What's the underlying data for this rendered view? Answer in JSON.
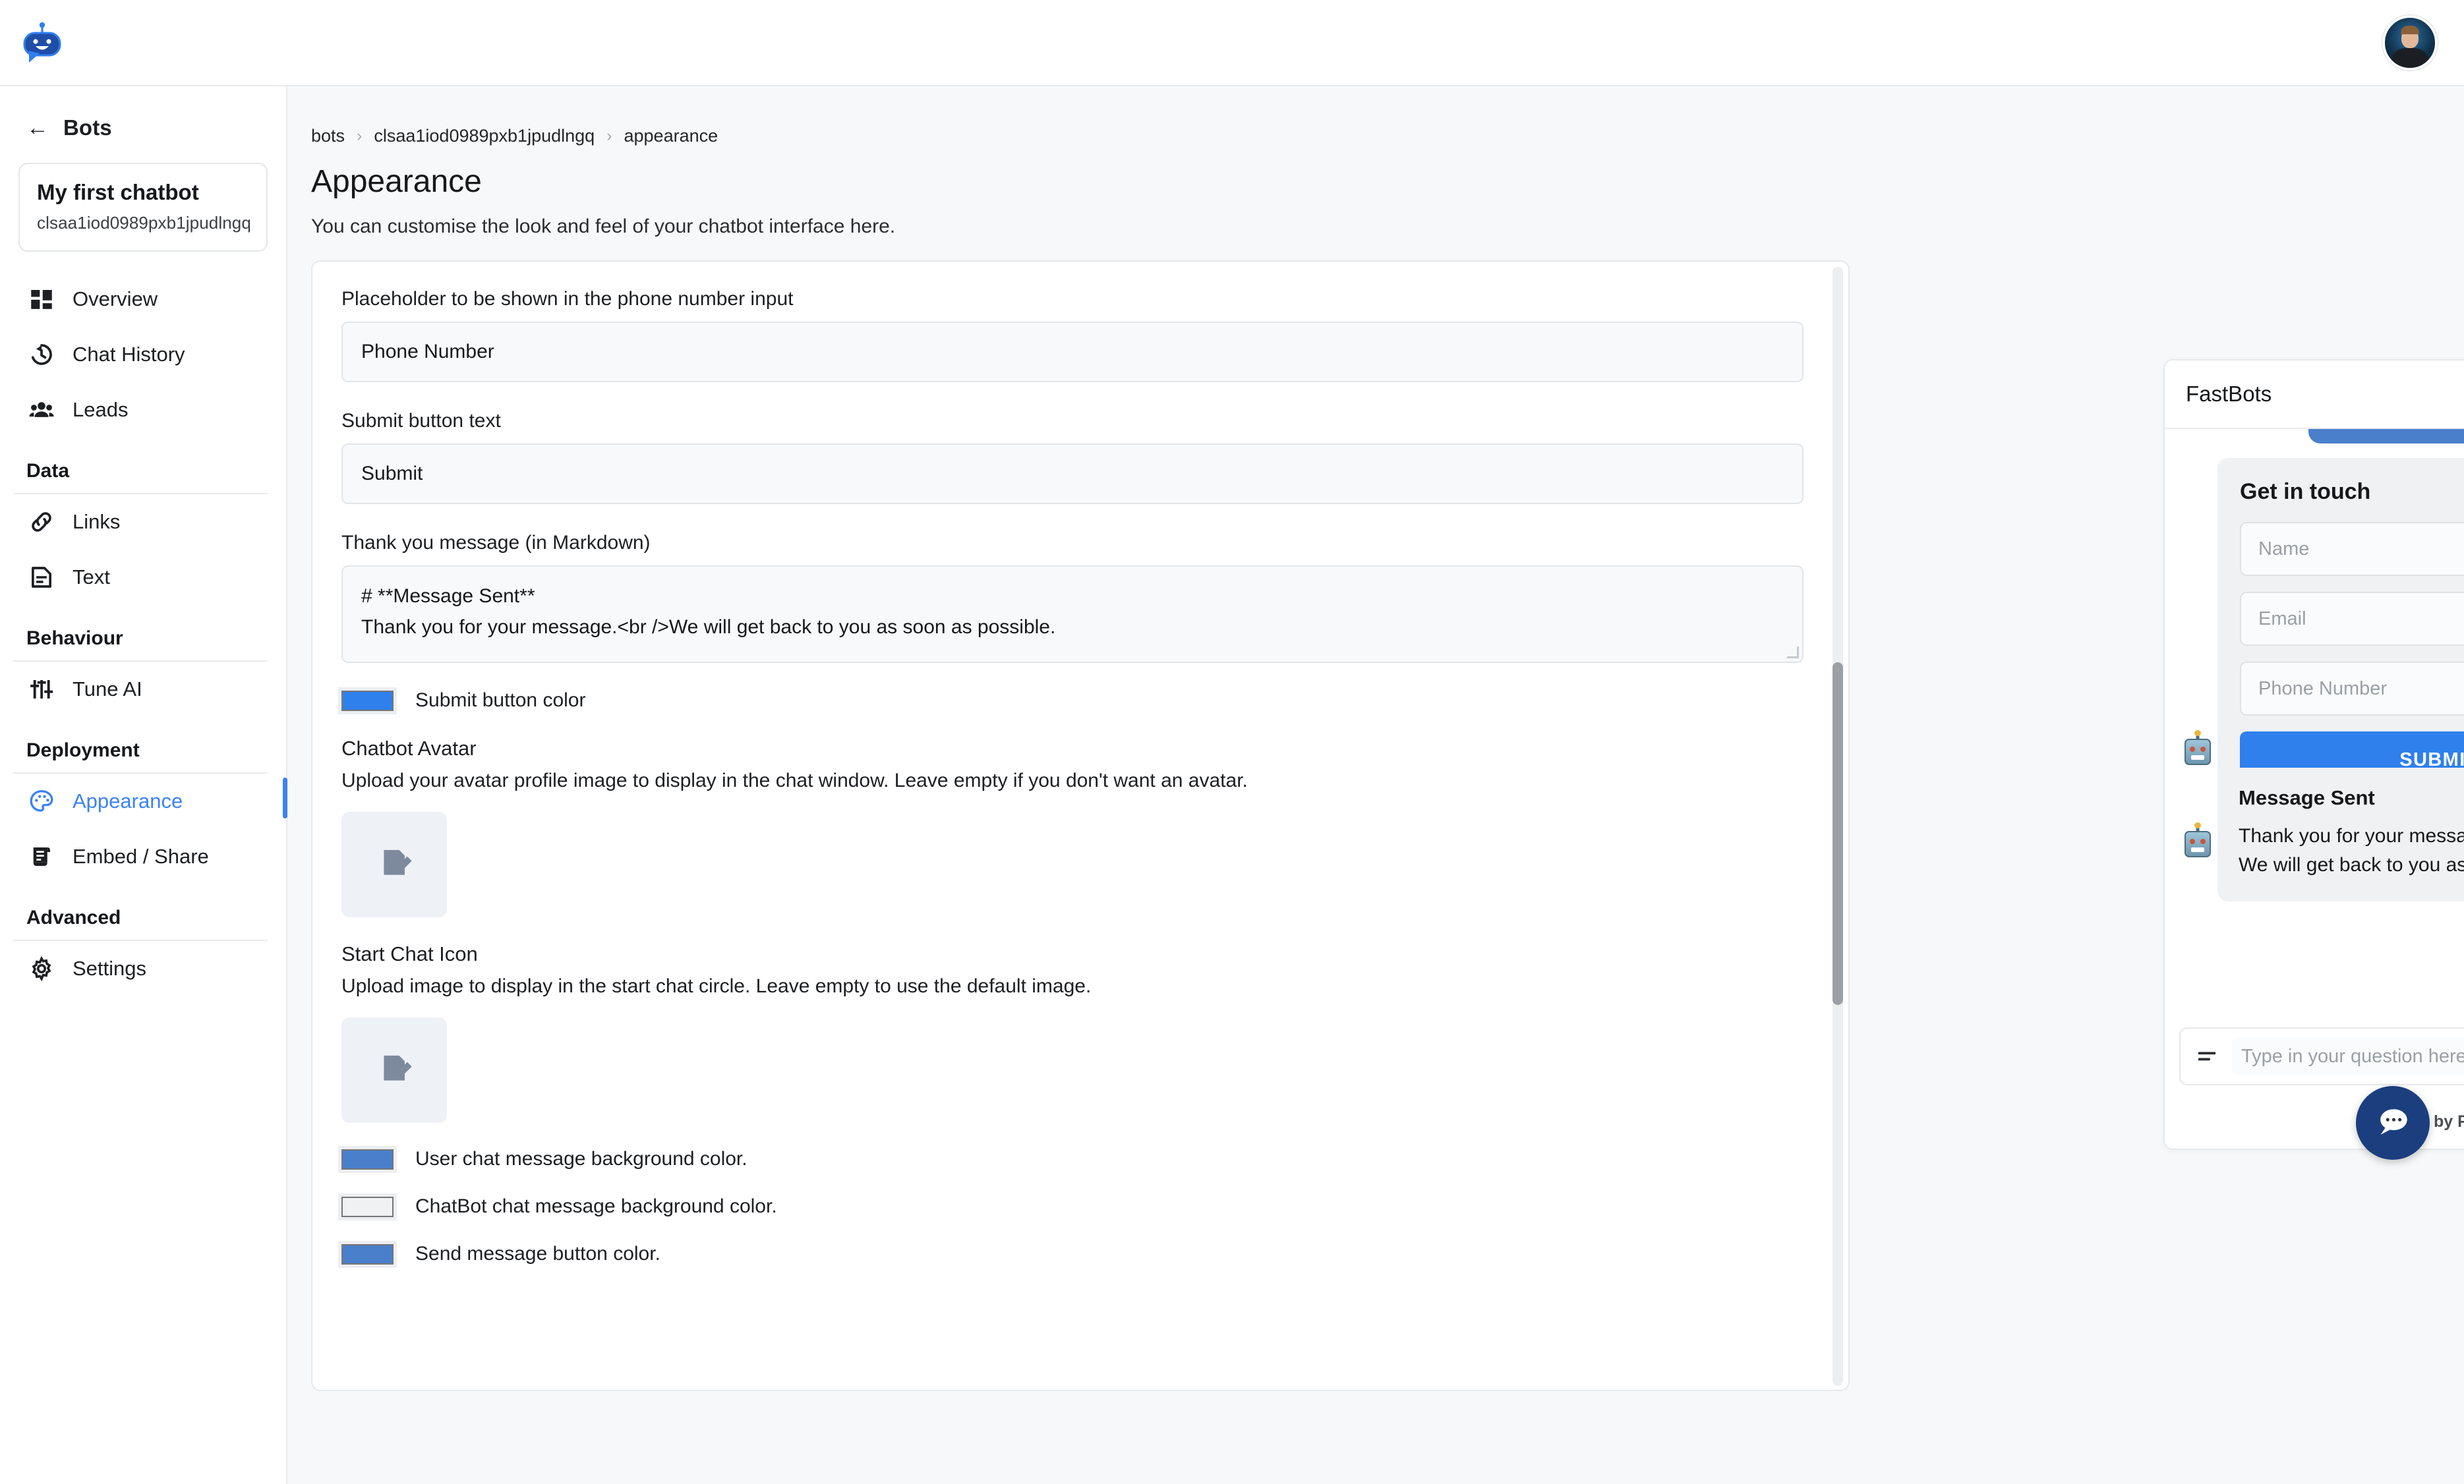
{
  "topbar": {
    "logo_icon": "fastbots-robot-logo",
    "avatar_icon": "user-avatar"
  },
  "sidebar": {
    "back_label": "Bots",
    "bot": {
      "name": "My first chatbot",
      "id": "clsaa1iod0989pxb1jpudlngq"
    },
    "nav": [
      {
        "label": "Overview",
        "icon": "dashboard-icon"
      },
      {
        "label": "Chat History",
        "icon": "history-icon"
      },
      {
        "label": "Leads",
        "icon": "people-icon"
      }
    ],
    "sections": [
      {
        "title": "Data",
        "items": [
          {
            "label": "Links",
            "icon": "link-icon"
          },
          {
            "label": "Text",
            "icon": "document-icon"
          }
        ]
      },
      {
        "title": "Behaviour",
        "items": [
          {
            "label": "Tune AI",
            "icon": "tune-icon"
          }
        ]
      },
      {
        "title": "Deployment",
        "items": [
          {
            "label": "Appearance",
            "icon": "palette-icon",
            "active": true
          },
          {
            "label": "Embed / Share",
            "icon": "scroll-icon"
          }
        ]
      },
      {
        "title": "Advanced",
        "items": [
          {
            "label": "Settings",
            "icon": "gear-icon"
          }
        ]
      }
    ]
  },
  "breadcrumb": {
    "item1": "bots",
    "item2": "clsaa1iod0989pxb1jpudlngq",
    "item3": "appearance",
    "sep": "›"
  },
  "page": {
    "title": "Appearance",
    "subtitle": "You can customise the look and feel of your chatbot interface here."
  },
  "form": {
    "phone_placeholder_label": "Placeholder to be shown in the phone number input",
    "phone_placeholder_value": "Phone Number",
    "submit_text_label": "Submit button text",
    "submit_text_value": "Submit",
    "thankyou_label": "Thank you message (in Markdown)",
    "thankyou_line1": "# **Message Sent**",
    "thankyou_line2": "Thank you for your message.<br />We will get back to you as soon as possible.",
    "submit_color_label": "Submit button color",
    "submit_color_value": "#2f80ed",
    "avatar_title": "Chatbot Avatar",
    "avatar_desc": "Upload your avatar profile image to display in the chat window. Leave empty if you don't want an avatar.",
    "avatar_upload_icon": "image-upload-icon",
    "start_icon_title": "Start Chat Icon",
    "start_icon_desc": "Upload image to display in the start chat circle. Leave empty to use the default image.",
    "start_icon_upload_icon": "image-upload-icon",
    "user_bg_label": "User chat message background color.",
    "user_bg_value": "#4a7fcc",
    "bot_bg_label": "ChatBot chat message background color.",
    "bot_bg_value": "#f0f1f3",
    "send_btn_label": "Send message button color.",
    "send_btn_value": "#4a7fcc"
  },
  "chat_preview": {
    "title": "FastBots",
    "close_icon": "close-icon",
    "form": {
      "heading": "Get in touch",
      "name_placeholder": "Name",
      "email_placeholder": "Email",
      "phone_placeholder": "Phone Number",
      "submit_label": "SUBMIT"
    },
    "bot_message": {
      "title": "Message Sent",
      "line1": "Thank you for your message.",
      "line2": "We will get back to you as soon as possible."
    },
    "input_placeholder": "Type in your question here",
    "menu_icon": "lines-icon",
    "send_icon": "send-icon",
    "footer": "Powered by FastBots",
    "bot_avatar_icon": "robot-avatar-icon"
  },
  "fab": {
    "icon": "chat-bubble-icon"
  }
}
